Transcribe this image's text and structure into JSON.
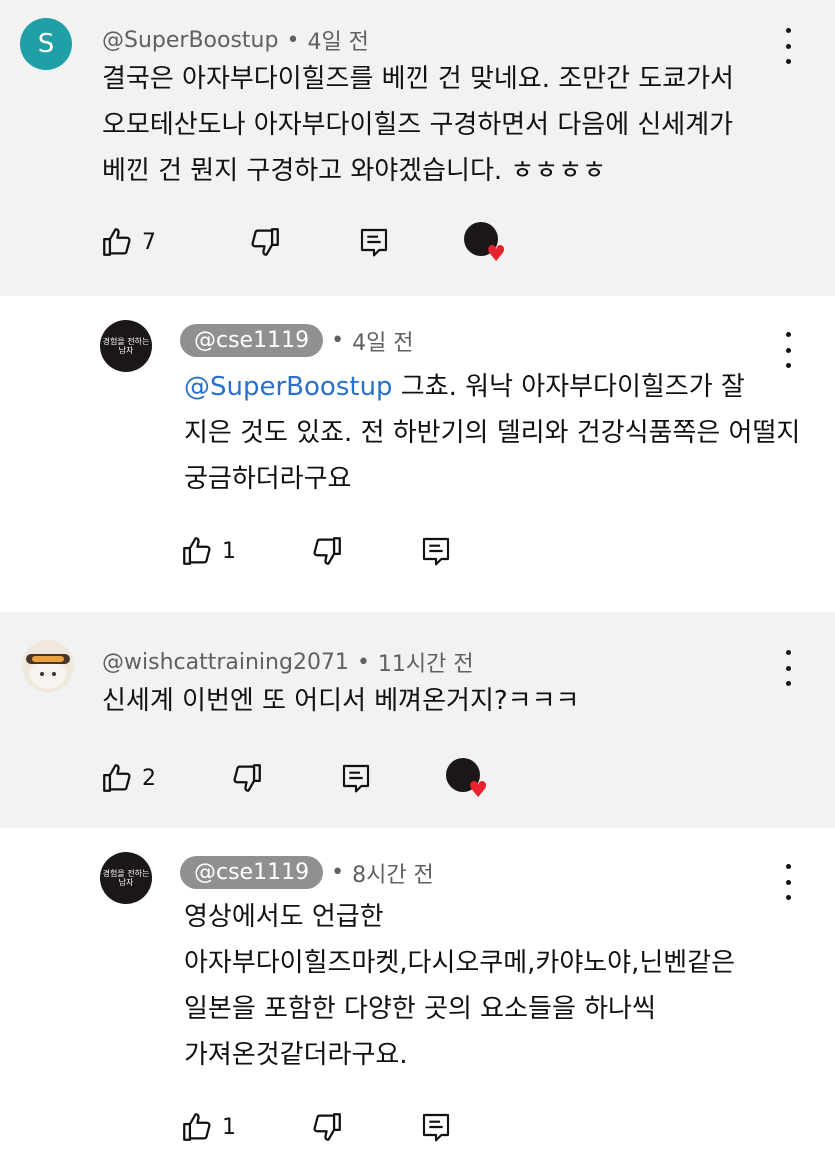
{
  "comments": [
    {
      "avatar_letter": "S",
      "author": "@SuperBoostup",
      "time": "4일 전",
      "lines": [
        "결국은 아자부다이힐즈를 베낀 건 맞네요. 조만간 도쿄가서",
        "오모테산도나 아자부다이힐즈 구경하면서 다음에 신세계가",
        "베낀 건 뭔지 구경하고 와야겠습니다. ㅎㅎㅎㅎ"
      ],
      "likes": "7"
    },
    {
      "avatar_text": "경험을 전하는남자",
      "author": "@cse1119",
      "time": "4일 전",
      "mention": "@SuperBoostup",
      "lines": [
        " 그쵸. 워낙 아자부다이힐즈가 잘",
        "지은 것도 있죠. 전 하반기의 델리와 건강식품쪽은 어떨지",
        "궁금하더라구요"
      ],
      "likes": "1"
    },
    {
      "author": "@wishcattraining2071",
      "time": "11시간 전",
      "lines": [
        "신세계 이번엔 또 어디서 베껴온거지?ㅋㅋㅋ"
      ],
      "likes": "2"
    },
    {
      "avatar_text": "경험을 전하는남자",
      "author": "@cse1119",
      "time": "8시간 전",
      "lines": [
        "영상에서도 언급한",
        "아자부다이힐즈마켓,다시오쿠메,카야노야,닌벤같은",
        "일본을 포함한 다양한 곳의 요소들을 하나씩",
        "가져온것같더라구요."
      ],
      "likes": "1"
    }
  ],
  "icons": {
    "like": "thumbs-up-icon",
    "dislike": "thumbs-down-icon",
    "reply": "reply-icon",
    "menu": "more-vert-icon",
    "heart": "heart-icon"
  },
  "colors": {
    "gray_bg": "#f2f2f2",
    "mention": "#2a72c9",
    "heart": "#e8222e",
    "avatar_s": "#1f9fa6"
  }
}
